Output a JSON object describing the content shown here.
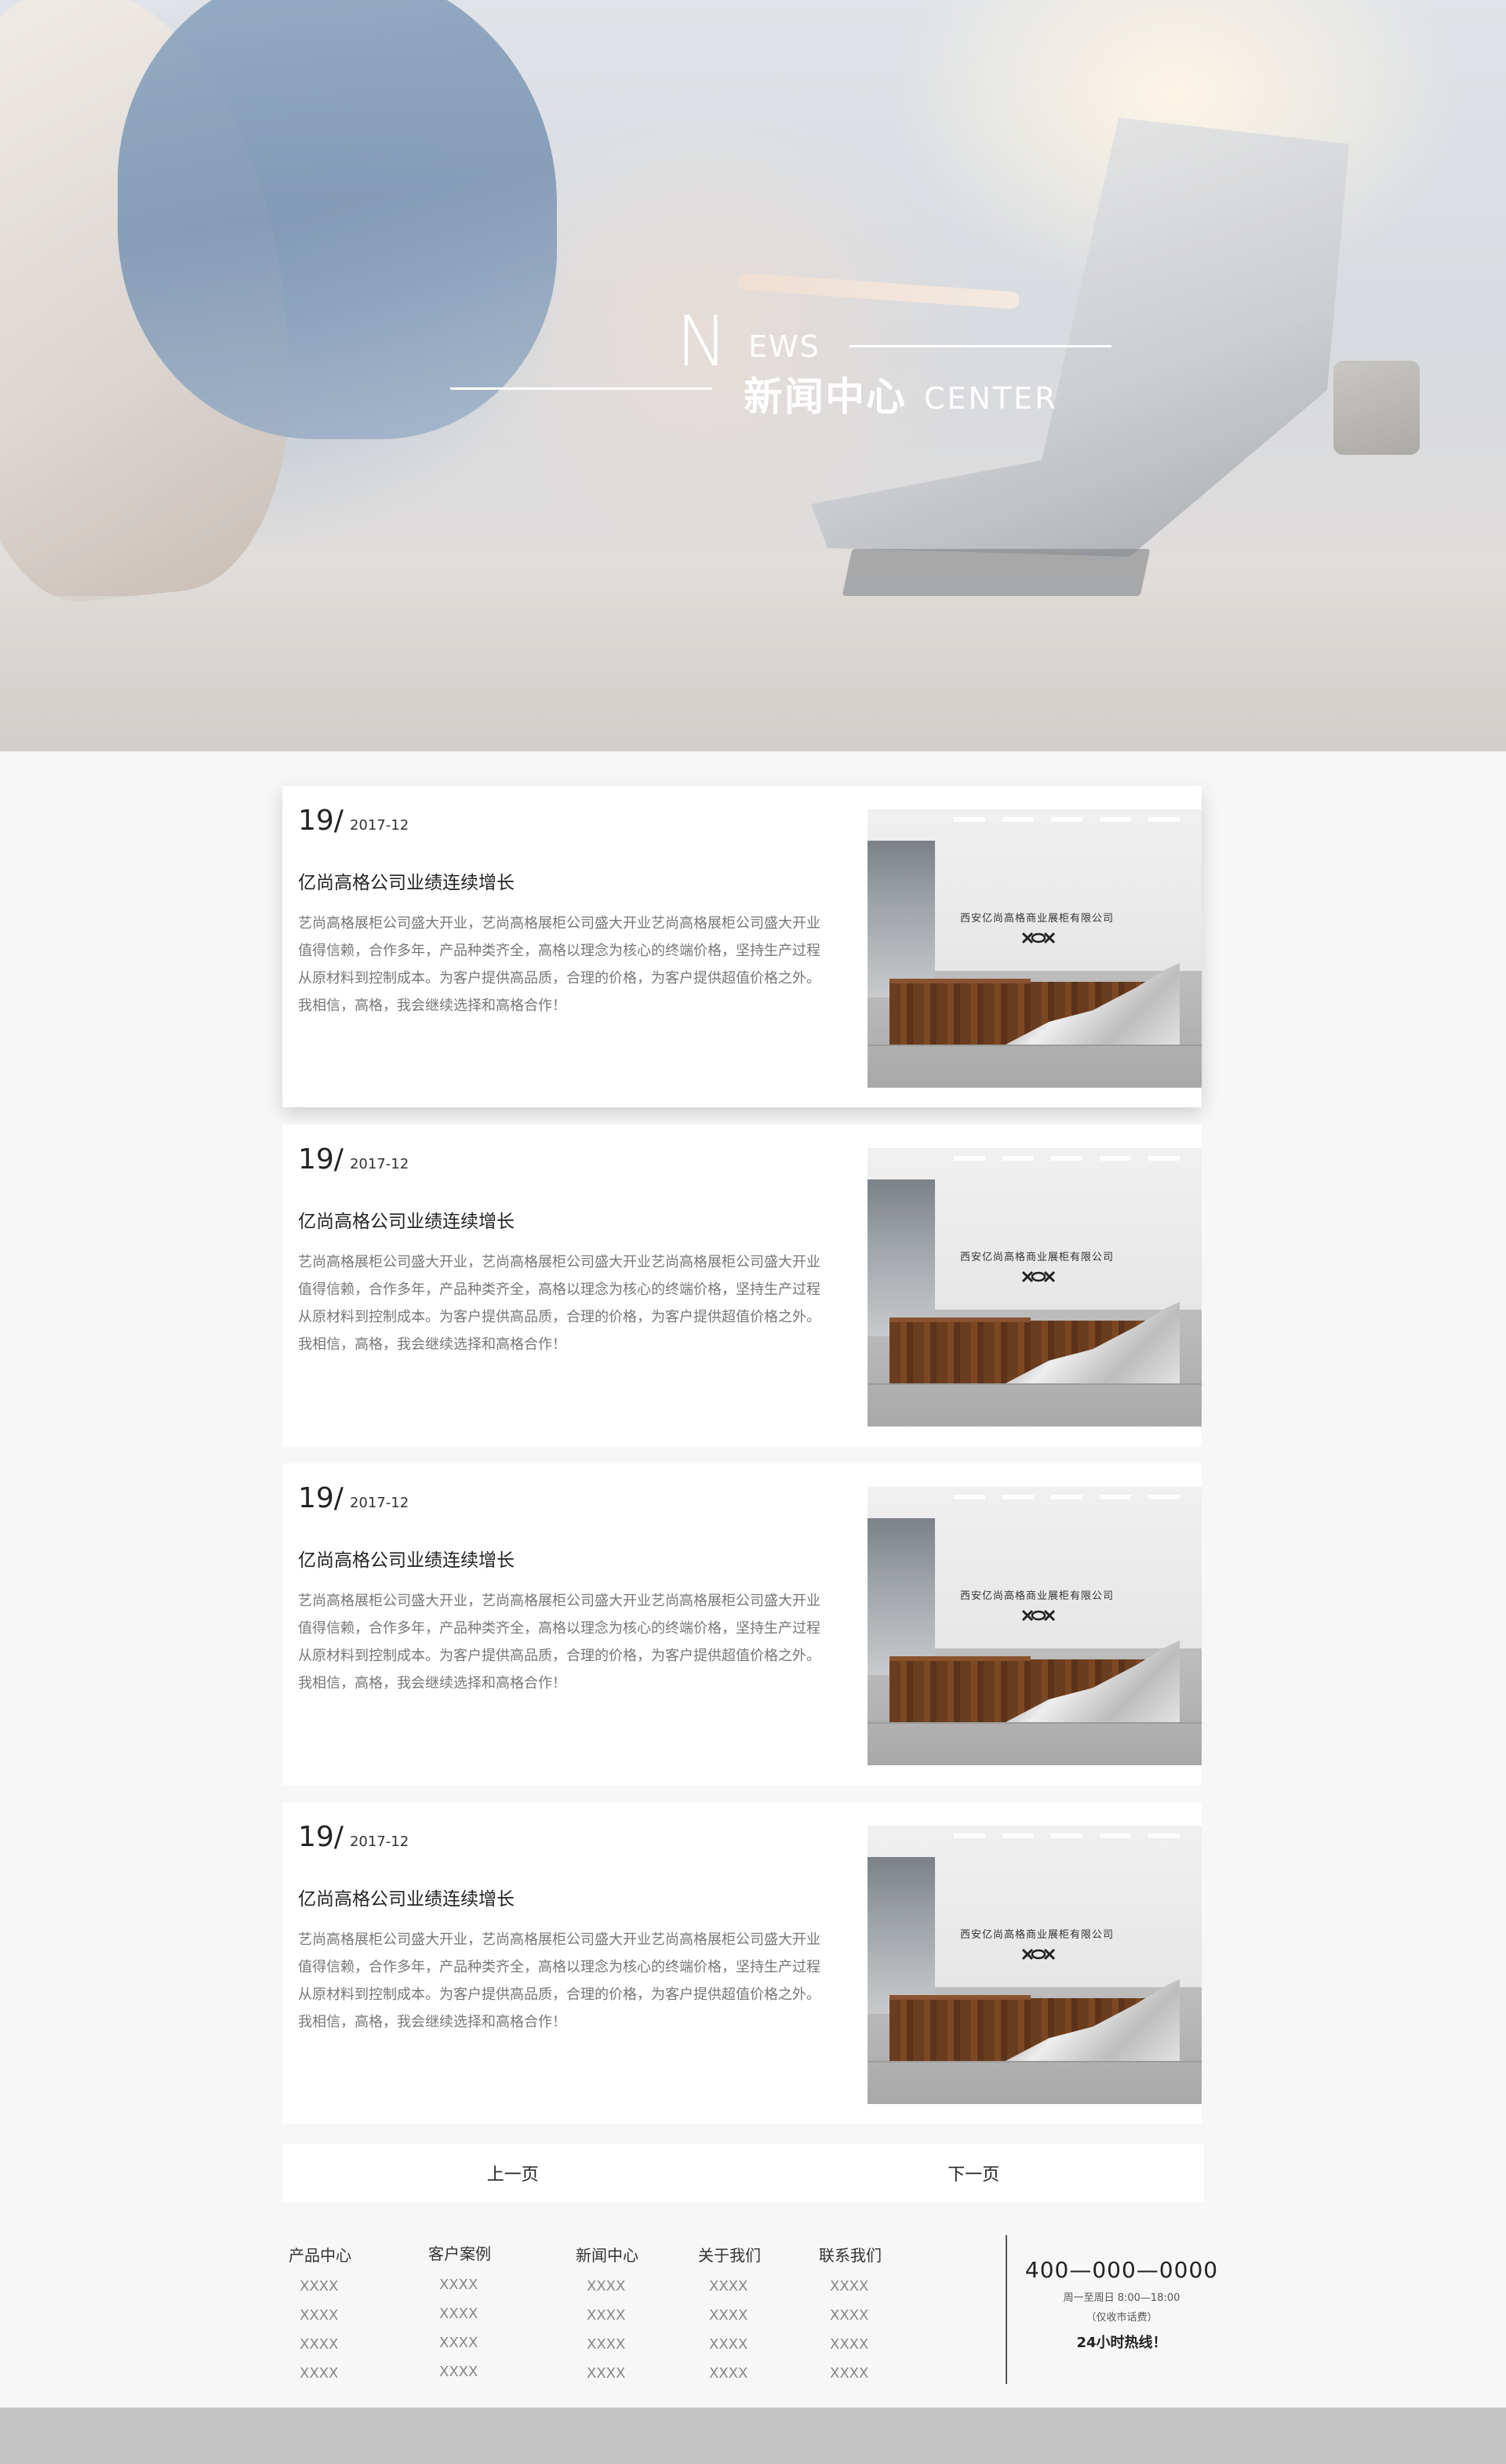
{
  "hero": {
    "initial": "N",
    "word_rest": "EWS",
    "title_cn": "新闻中心",
    "title_en": "CENTER"
  },
  "news": [
    {
      "day": "19/",
      "year_month": "2017-12",
      "title": "亿尚高格公司业绩连续增长",
      "body": "艺尚高格展柜公司盛大开业，艺尚高格展柜公司盛大开业艺尚高格展柜公司盛大开业值得信赖，合作多年，产品种类齐全，高格以理念为核心的终端价格，坚持生产过程从原材料到控制成本。为客户提供高品质，合理的价格，为客户提供超值价格之外。我相信，高格，我会继续选择和高格合作！",
      "sign": "西安亿尚高格商业展柜有限公司"
    },
    {
      "day": "19/",
      "year_month": "2017-12",
      "title": "亿尚高格公司业绩连续增长",
      "body": "艺尚高格展柜公司盛大开业，艺尚高格展柜公司盛大开业艺尚高格展柜公司盛大开业值得信赖，合作多年，产品种类齐全，高格以理念为核心的终端价格，坚持生产过程从原材料到控制成本。为客户提供高品质，合理的价格，为客户提供超值价格之外。我相信，高格，我会继续选择和高格合作！",
      "sign": "西安亿尚高格商业展柜有限公司"
    },
    {
      "day": "19/",
      "year_month": "2017-12",
      "title": "亿尚高格公司业绩连续增长",
      "body": "艺尚高格展柜公司盛大开业，艺尚高格展柜公司盛大开业艺尚高格展柜公司盛大开业值得信赖，合作多年，产品种类齐全，高格以理念为核心的终端价格，坚持生产过程从原材料到控制成本。为客户提供高品质，合理的价格，为客户提供超值价格之外。我相信，高格，我会继续选择和高格合作！",
      "sign": "西安亿尚高格商业展柜有限公司"
    },
    {
      "day": "19/",
      "year_month": "2017-12",
      "title": "亿尚高格公司业绩连续增长",
      "body": "艺尚高格展柜公司盛大开业，艺尚高格展柜公司盛大开业艺尚高格展柜公司盛大开业值得信赖，合作多年，产品种类齐全，高格以理念为核心的终端价格，坚持生产过程从原材料到控制成本。为客户提供高品质，合理的价格，为客户提供超值价格之外。我相信，高格，我会继续选择和高格合作！",
      "sign": "西安亿尚高格商业展柜有限公司"
    }
  ],
  "pager": {
    "prev": "上一页",
    "next": "下一页"
  },
  "footer": {
    "columns": [
      {
        "head": "产品中心",
        "links": [
          "XXXX",
          "XXXX",
          "XXXX",
          "XXXX"
        ]
      },
      {
        "head": "客户案例",
        "links": [
          "XXXX",
          "XXXX",
          "XXXX",
          "XXXX"
        ]
      },
      {
        "head": "新闻中心",
        "links": [
          "XXXX",
          "XXXX",
          "XXXX",
          "XXXX"
        ]
      },
      {
        "head": "关于我们",
        "links": [
          "XXXX",
          "XXXX",
          "XXXX",
          "XXXX"
        ]
      },
      {
        "head": "联系我们",
        "links": [
          "XXXX",
          "XXXX",
          "XXXX",
          "XXXX"
        ]
      }
    ],
    "hotline": {
      "phone": "400—000—0000",
      "hours": "周一至周日 8:00—18:00",
      "note": "（仅收市话费）",
      "label": "24小时热线！"
    }
  },
  "colors": {
    "page_bg": "#f7f7f7",
    "card_bg": "#ffffff",
    "bottom_bar": "#c4c4c4",
    "hero_text": "#ffffff"
  }
}
